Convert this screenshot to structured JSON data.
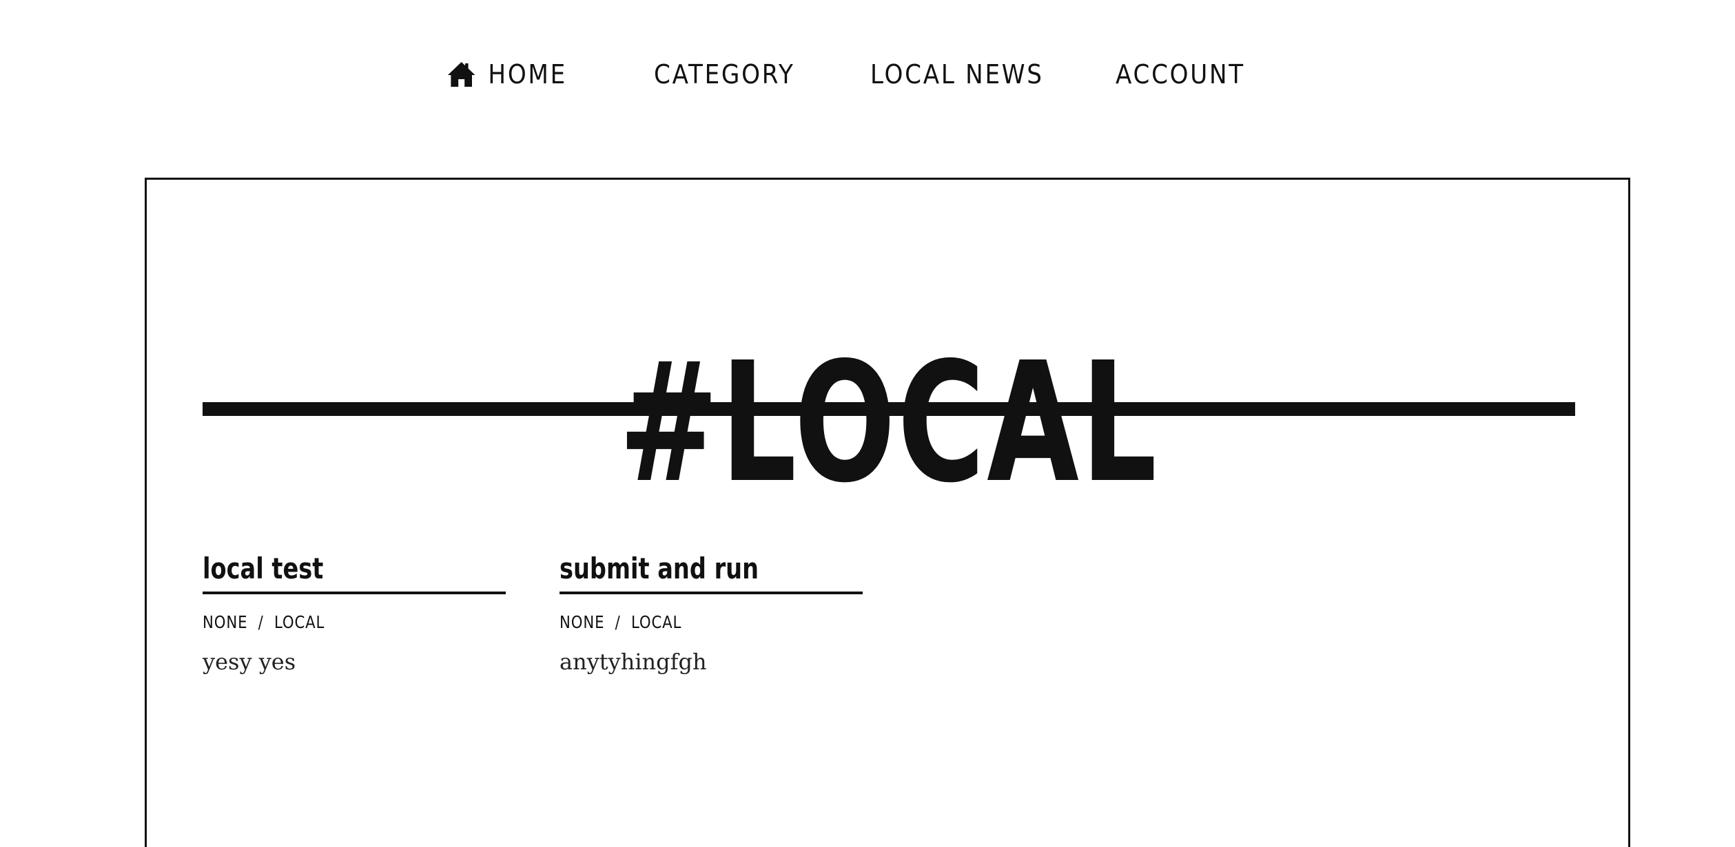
{
  "nav": {
    "home_icon": "home-icon",
    "home_label": "HOME",
    "category_label": "CATEGORY",
    "local_news_label": "LOCAL NEWS",
    "account_label": "ACCOUNT"
  },
  "page": {
    "title": "#LOCAL"
  },
  "posts": [
    {
      "title": "local test",
      "meta": [
        "NONE",
        "LOCAL"
      ],
      "separator": "/",
      "excerpt": "yesy yes"
    },
    {
      "title": "submit and run",
      "meta": [
        "NONE",
        "LOCAL"
      ],
      "separator": "/",
      "excerpt": "anytyhingfgh"
    }
  ],
  "colors": {
    "text": "#111111",
    "background": "#ffffff",
    "excerpt": "#222222"
  }
}
